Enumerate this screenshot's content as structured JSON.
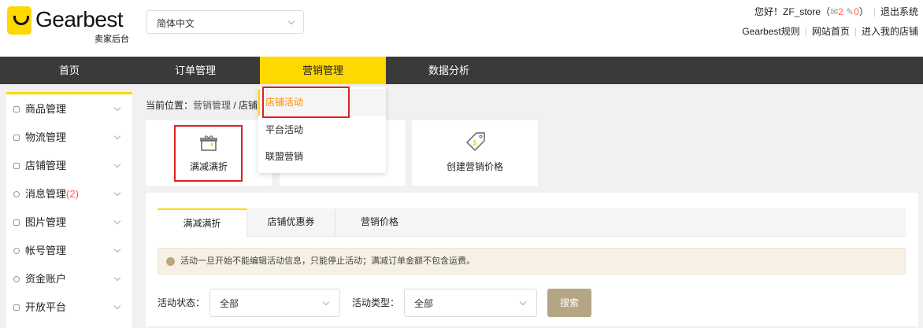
{
  "header": {
    "logo_text": "Gearbest",
    "logo_sub": "卖家后台",
    "language": "简体中文",
    "greeting": "您好！ZF_store（",
    "mail_count": "2",
    "edit_count": "0",
    "close_paren": "）",
    "logout": "退出系统",
    "links": [
      "Gearbest规则",
      "网站首页",
      "进入我的店铺"
    ]
  },
  "nav": {
    "items": [
      "首页",
      "订单管理",
      "营销管理",
      "数据分析"
    ]
  },
  "dropdown": {
    "items": [
      "店铺活动",
      "平台活动",
      "联盟营销"
    ]
  },
  "sidebar": {
    "items": [
      {
        "label": "商品管理"
      },
      {
        "label": "物流管理"
      },
      {
        "label": "店铺管理"
      },
      {
        "label": "消息管理",
        "badge": "(2)"
      },
      {
        "label": "图片管理"
      },
      {
        "label": "帐号管理"
      },
      {
        "label": "资金账户"
      },
      {
        "label": "开放平台"
      }
    ]
  },
  "breadcrumb": {
    "prefix": "当前位置：",
    "parent": "营销管理",
    "sep": " / ",
    "current": "店铺活动"
  },
  "cards": [
    "满减满折",
    "创建营销价格"
  ],
  "tabs": [
    "满减满折",
    "店铺优惠券",
    "营销价格"
  ],
  "notice": "活动一旦开始不能编辑活动信息，只能停止活动；满减订单金额不包含运费。",
  "filters": {
    "status_label": "活动状态：",
    "status_value": "全部",
    "type_label": "活动类型：",
    "type_value": "全部",
    "search": "搜索"
  },
  "colors": {
    "accent": "#ffd800",
    "nav_bg": "#3a3a3a",
    "highlight": "#e02020"
  }
}
